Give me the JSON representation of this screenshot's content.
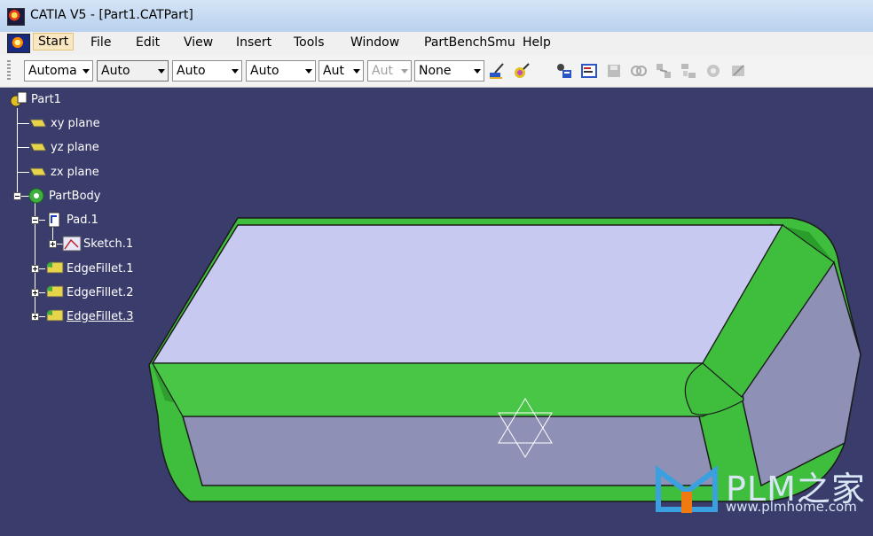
{
  "window": {
    "title": "CATIA V5 - [Part1.CATPart]"
  },
  "menu": [
    "Start",
    "File",
    "Edit",
    "View",
    "Insert",
    "Tools",
    "Window",
    "PartBenchSmu",
    "Help"
  ],
  "toolbar": {
    "combos": [
      "Automa",
      "Auto",
      "Auto",
      "Auto",
      "Aut",
      "Aut",
      "None"
    ],
    "icons": [
      "paint-brush-icon",
      "magic-wand-icon",
      "properties-icon",
      "layer-properties-icon",
      "save-icon",
      "link-icon",
      "network-icon",
      "structure-icon",
      "tools-icon",
      "settings-icon"
    ]
  },
  "tree": {
    "root": "Part1",
    "planes": [
      "xy plane",
      "yz plane",
      "zx plane"
    ],
    "body": "PartBody",
    "pad": "Pad.1",
    "sketch": "Sketch.1",
    "fillets": [
      "EdgeFillet.1",
      "EdgeFillet.2",
      "EdgeFillet.3"
    ]
  },
  "watermark": {
    "brand": "PLM之家",
    "url": "www.plmhome.com"
  },
  "colors": {
    "background": "#3a3c6c",
    "top_face": "#c8c9f0",
    "side_face": "#8f90b5",
    "fillet": "#3fbd3c",
    "fillet_dark": "#2a9e2a"
  }
}
